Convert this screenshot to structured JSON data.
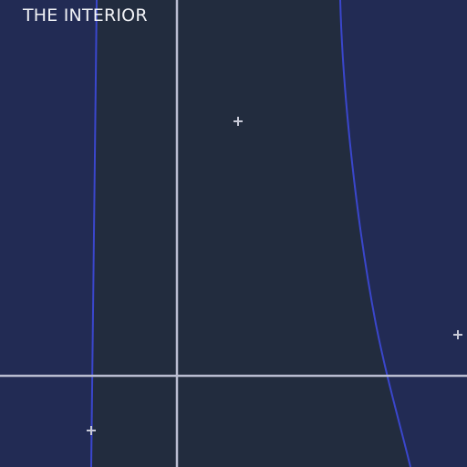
{
  "title": "THE INTERIOR",
  "colors": {
    "outside": "#222b54",
    "inside": "#222c3e",
    "boundary": "#3a46cc",
    "axis": "#b9bcd0",
    "marker": "#c8cad8",
    "title": "#f2f3f7"
  },
  "markers": [
    {
      "name": "marker-top",
      "icon": "plus-icon"
    },
    {
      "name": "marker-right",
      "icon": "plus-icon"
    },
    {
      "name": "marker-bottom-left",
      "icon": "plus-icon"
    }
  ]
}
